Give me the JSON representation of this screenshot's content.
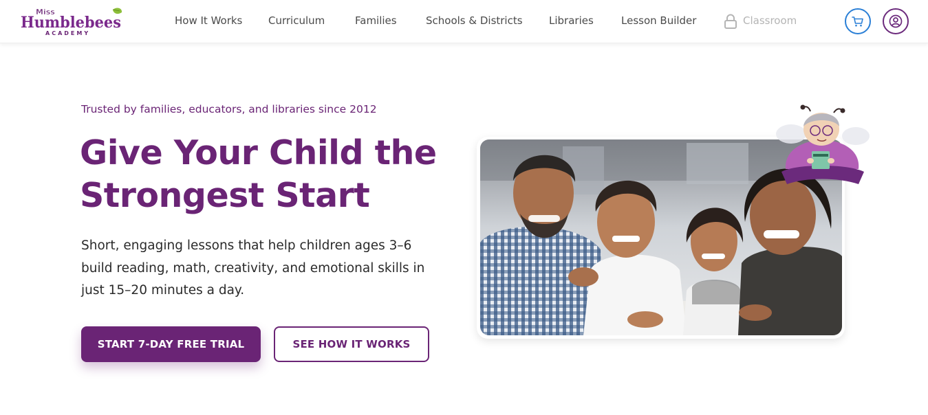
{
  "brand": {
    "logo_top": "Miss",
    "logo_main": "Humblebees",
    "logo_sub": "ACADEMY",
    "primary_color": "#6a2475",
    "accent_color": "#2a7fd6"
  },
  "nav": {
    "items": [
      {
        "label": "How It Works"
      },
      {
        "label": "Curriculum"
      },
      {
        "label": "Families"
      },
      {
        "label": "Schools & Districts"
      },
      {
        "label": "Libraries"
      },
      {
        "label": "Lesson Builder"
      }
    ],
    "classroom_label": "Classroom",
    "lock_icon": "lock-icon",
    "cart_icon": "cart-icon",
    "account_icon": "user-circle-icon"
  },
  "hero": {
    "eyebrow": "Trusted by families, educators, and libraries since 2012",
    "headline_line1": "Give Your Child the",
    "headline_line2": "Strongest Start",
    "subtext": "Short, engaging lessons that help children ages 3–6 build reading, math, creativity, and emotional skills in just 15–20 minutes a day.",
    "primary_cta": "START 7-DAY FREE TRIAL",
    "secondary_cta": "SEE HOW IT WORKS"
  }
}
